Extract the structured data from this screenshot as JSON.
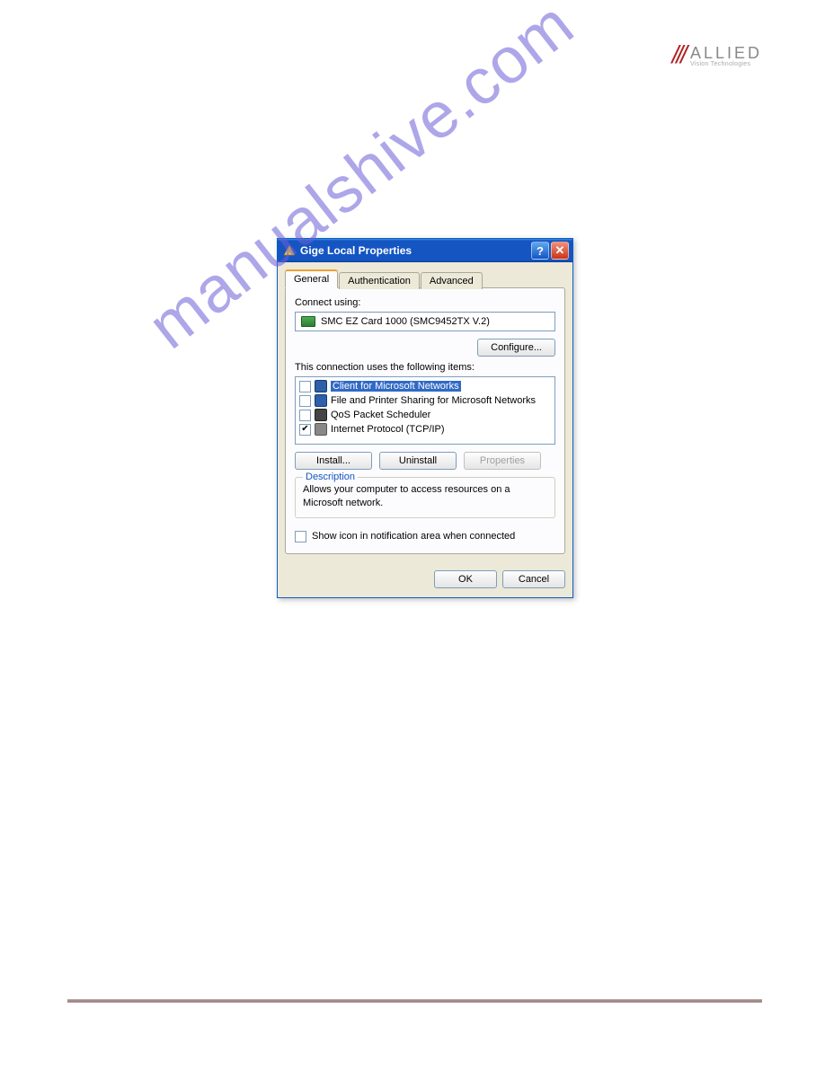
{
  "logo": {
    "name": "ALLIED",
    "sub": "Vision Technologies"
  },
  "watermark": "manualshive.com",
  "dialog": {
    "title": "Gige Local Properties",
    "tabs": {
      "general": "General",
      "authentication": "Authentication",
      "advanced": "Advanced"
    },
    "connect_using_label": "Connect using:",
    "adapter": "SMC EZ Card 1000 (SMC9452TX V.2)",
    "configure_btn": "Configure...",
    "items_label": "This connection uses the following items:",
    "items": [
      {
        "checked": false,
        "selected": true,
        "text": "Client for Microsoft Networks"
      },
      {
        "checked": false,
        "selected": false,
        "text": "File and Printer Sharing for Microsoft Networks"
      },
      {
        "checked": false,
        "selected": false,
        "text": "QoS Packet Scheduler"
      },
      {
        "checked": true,
        "selected": false,
        "text": "Internet Protocol (TCP/IP)"
      }
    ],
    "install_btn": "Install...",
    "uninstall_btn": "Uninstall",
    "properties_btn": "Properties",
    "description_legend": "Description",
    "description_text": "Allows your computer to access resources on a Microsoft network.",
    "show_icon_label": "Show icon in notification area when connected",
    "ok_btn": "OK",
    "cancel_btn": "Cancel"
  }
}
